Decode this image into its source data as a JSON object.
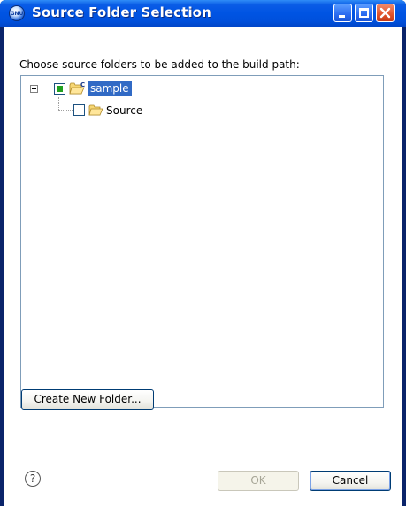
{
  "window": {
    "title": "Source Folder Selection",
    "app_icon_text": "GNU"
  },
  "dialog": {
    "instruction": "Choose source folders to be added to the build path:",
    "tree": {
      "root": {
        "label": "sample",
        "checked": "partial",
        "expanded": true,
        "selected": true
      },
      "children": [
        {
          "label": "Source",
          "checked": false
        }
      ]
    },
    "create_folder_label": "Create New Folder...",
    "ok_label": "OK",
    "cancel_label": "Cancel",
    "help_glyph": "?"
  },
  "colors": {
    "titlebar": "#0054e3",
    "selection": "#316ac5",
    "partial_check": "#21a121",
    "close_button": "#e0532b"
  }
}
